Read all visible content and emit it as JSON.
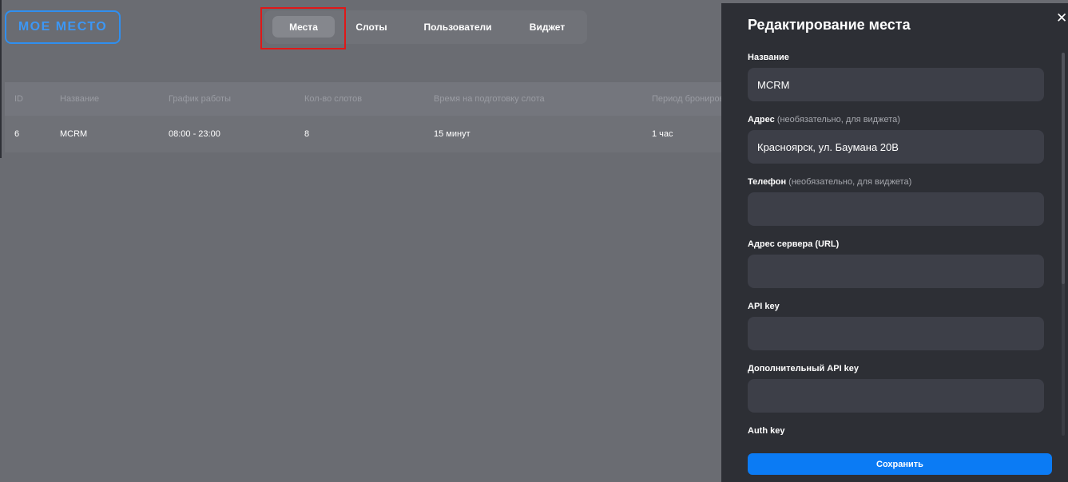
{
  "brand": {
    "logo": "МОЕ МЕСТО"
  },
  "nav": {
    "items": [
      {
        "label": "Места",
        "active": true
      },
      {
        "label": "Слоты",
        "active": false
      },
      {
        "label": "Пользователи",
        "active": false
      },
      {
        "label": "Виджет",
        "active": false
      }
    ]
  },
  "table": {
    "headers": [
      "ID",
      "Название",
      "График работы",
      "Кол-во слотов",
      "Время на подготовку слота",
      "Период брониров"
    ],
    "rows": [
      [
        "6",
        "MCRM",
        "08:00 - 23:00",
        "8",
        "15 минут",
        "1 час"
      ]
    ]
  },
  "panel": {
    "title": "Редактирование места",
    "close_icon": "close-icon",
    "fields": [
      {
        "label": "Название",
        "hint": "",
        "value": "MCRM"
      },
      {
        "label": "Адрес",
        "hint": "(необязательно, для виджета)",
        "value": "Красноярск, ул. Баумана 20В"
      },
      {
        "label": "Телефон",
        "hint": "(необязательно, для виджета)",
        "value": ""
      },
      {
        "label": "Адрес сервера (URL)",
        "hint": "",
        "value": ""
      },
      {
        "label": "API key",
        "hint": "",
        "value": ""
      },
      {
        "label": "Дополнительный API key",
        "hint": "",
        "value": ""
      },
      {
        "label": "Auth key",
        "hint": "",
        "value": ""
      }
    ],
    "save_label": "Сохранить"
  },
  "colors": {
    "accent": "#0b7bf4",
    "logo_blue": "#3c97f5",
    "panel_bg": "#2d2f35",
    "input_bg": "#3d3f48",
    "highlight_red": "#e01818"
  }
}
